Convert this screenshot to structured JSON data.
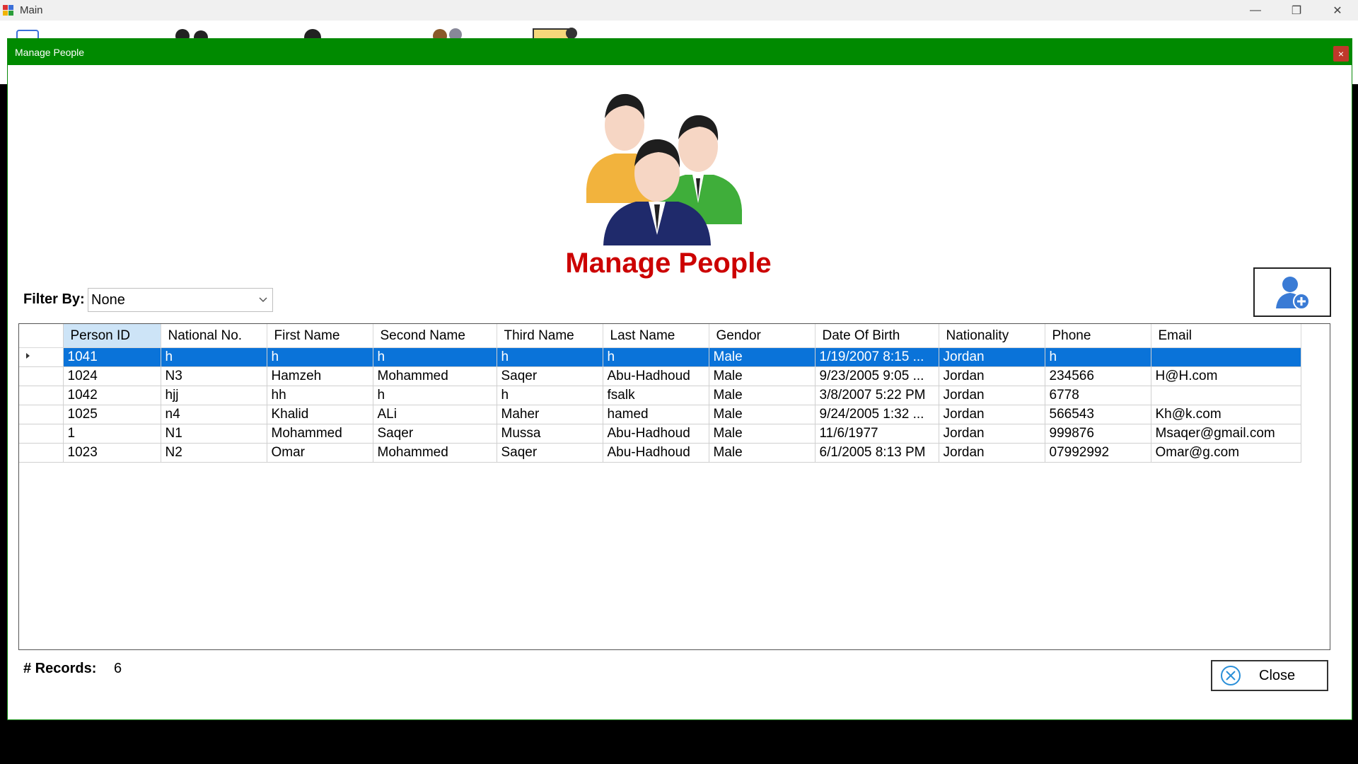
{
  "main_window": {
    "title": "Main",
    "controls": {
      "minimize": "—",
      "maximize": "❐",
      "close": "✕"
    }
  },
  "dialog": {
    "title": "Manage People",
    "close_glyph": "×",
    "heading": "Manage People",
    "filter": {
      "label": "Filter By:",
      "selected": "None"
    },
    "table": {
      "columns": [
        "Person ID",
        "National No.",
        "First Name",
        "Second Name",
        "Third Name",
        "Last Name",
        "Gendor",
        "Date Of Birth",
        "Nationality",
        "Phone",
        "Email"
      ],
      "rows": [
        [
          "1041",
          "h",
          "h",
          "h",
          "h",
          "h",
          "Male",
          "1/19/2007 8:15 ...",
          "Jordan",
          "h",
          ""
        ],
        [
          "1024",
          "N3",
          "Hamzeh",
          "Mohammed",
          "Saqer",
          "Abu-Hadhoud",
          "Male",
          "9/23/2005 9:05 ...",
          "Jordan",
          "234566",
          "H@H.com"
        ],
        [
          "1042",
          "hjj",
          "hh",
          "h",
          "h",
          "fsalk",
          "Male",
          "3/8/2007 5:22 PM",
          "Jordan",
          "6778",
          ""
        ],
        [
          "1025",
          "n4",
          "Khalid",
          "ALi",
          "Maher",
          "hamed",
          "Male",
          "9/24/2005 1:32 ...",
          "Jordan",
          "566543",
          "Kh@k.com"
        ],
        [
          "1",
          "N1",
          "Mohammed",
          "Saqer",
          "Mussa",
          "Abu-Hadhoud",
          "Male",
          "11/6/1977",
          "Jordan",
          "999876",
          "Msaqer@gmail.com"
        ],
        [
          "1023",
          "N2",
          "Omar",
          "Mohammed",
          "Saqer",
          "Abu-Hadhoud",
          "Male",
          "6/1/2005 8:13 PM",
          "Jordan",
          "07992992",
          "Omar@g.com"
        ]
      ],
      "selected_row": 0,
      "sorted_column": 0
    },
    "records": {
      "label": "# Records:",
      "count": "6"
    },
    "close_button": "Close"
  },
  "icons": {
    "people": "people-group-icon",
    "add_person": "add-person-icon",
    "close": "close-circle-icon",
    "dropdown": "chevron-down-icon",
    "row_pointer": "row-pointer-icon"
  },
  "colors": {
    "dialog_header": "#008a00",
    "heading": "#cc0000",
    "selection": "#0a73d9"
  }
}
